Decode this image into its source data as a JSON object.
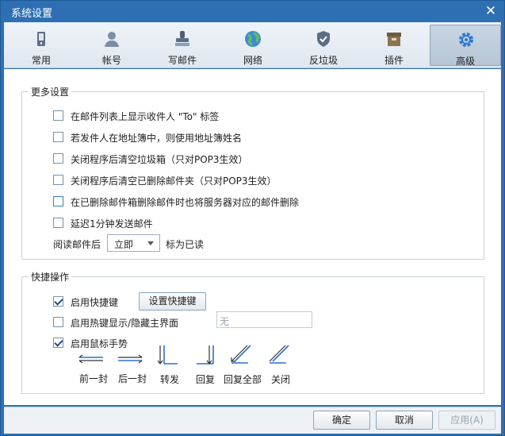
{
  "window": {
    "title": "系统设置",
    "close_glyph": "✕"
  },
  "tabs": [
    {
      "label": "常用",
      "icon": "phone-icon"
    },
    {
      "label": "帐号",
      "icon": "user-icon"
    },
    {
      "label": "写邮件",
      "icon": "stamp-icon"
    },
    {
      "label": "网络",
      "icon": "globe-icon"
    },
    {
      "label": "反垃圾",
      "icon": "shield-icon"
    },
    {
      "label": "插件",
      "icon": "box-icon"
    },
    {
      "label": "高级",
      "icon": "gear-icon",
      "active": true
    }
  ],
  "more": {
    "title": "更多设置",
    "options": [
      {
        "label": "在邮件列表上显示收件人 \"To\" 标签",
        "checked": false
      },
      {
        "label": "若发件人在地址簿中，则使用地址簿姓名",
        "checked": false
      },
      {
        "label": "关闭程序后清空垃圾箱（只对POP3生效）",
        "checked": false
      },
      {
        "label": "关闭程序后清空已删除邮件夹（只对POP3生效）",
        "checked": false
      },
      {
        "label": "在已删除邮件箱删除邮件时也将服务器对应的邮件删除",
        "checked": false
      },
      {
        "label": "延迟1分钟发送邮件",
        "checked": false
      }
    ],
    "read_label": "阅读邮件后",
    "read_value": "立即",
    "read_suffix": "标为已读"
  },
  "shortcuts": {
    "title": "快捷操作",
    "enable_hotkeys": {
      "label": "启用快捷键",
      "checked": true
    },
    "set_hotkeys_button": "设置快捷键",
    "hotkey_toggle": {
      "label": "启用热键显示/隐藏主界面",
      "checked": false
    },
    "hotkey_field_value": "无",
    "mouse_gestures": {
      "label": "启用鼠标手势",
      "checked": true
    },
    "gestures": [
      "前一封",
      "后一封",
      "转发",
      "回复",
      "回复全部",
      "关闭"
    ]
  },
  "footer": {
    "ok": "确定",
    "cancel": "取消",
    "apply": "应用(A)"
  },
  "colors": {
    "titlebar": "#2e6fb3",
    "gesture_blue": "#2f6fd0"
  }
}
